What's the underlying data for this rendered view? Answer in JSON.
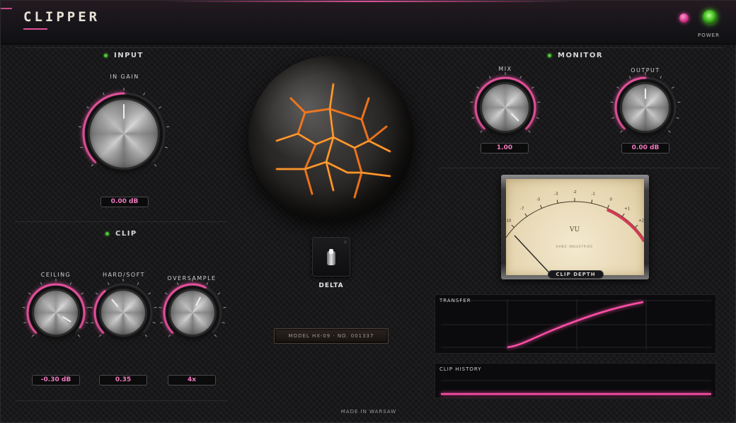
{
  "header": {
    "title": "CLIPPER",
    "power_label": "POWER"
  },
  "colors": {
    "accent": "#e0509a",
    "value_text": "#f07ac0",
    "power_led": "#4fe02a"
  },
  "input": {
    "title": "INPUT",
    "in_gain": {
      "label": "IN GAIN",
      "value": "0.00 dB",
      "level": 0.5
    }
  },
  "clip": {
    "title": "CLIP",
    "ceiling": {
      "label": "CEILING",
      "value": "-0.30 dB",
      "level": 0.95
    },
    "hard_soft": {
      "label": "HARD/SOFT",
      "value": "0.35",
      "level": 0.35
    },
    "oversample": {
      "label": "OVERSAMPLE",
      "value": "4x",
      "level": 0.6
    }
  },
  "monitor": {
    "title": "MONITOR",
    "mix": {
      "label": "MIX",
      "value": "1.00",
      "level": 1.0
    },
    "output": {
      "label": "OUTPUT",
      "value": "0.00 dB",
      "level": 0.5
    }
  },
  "delta": {
    "label": "DELTA"
  },
  "plate": {
    "text": "MODEL HX-09  ·  NO. 001337"
  },
  "vu_meter": {
    "label": "CLIP DEPTH",
    "unit": "VU",
    "scale": [
      "-20",
      "-10",
      "-7",
      "-5",
      "-3",
      "-2",
      "-1",
      "0",
      "+1",
      "+2",
      "+3"
    ],
    "maker": "KANO INDUSTRIES"
  },
  "transfer": {
    "title": "TRANSFER"
  },
  "clip_history": {
    "title": "CLIP HISTORY"
  },
  "footer": {
    "text": "MADE IN WARSAW"
  },
  "icons": {
    "power": "power-icon",
    "status_led": "led-icon",
    "delta_toggle": "toggle-switch-icon"
  }
}
